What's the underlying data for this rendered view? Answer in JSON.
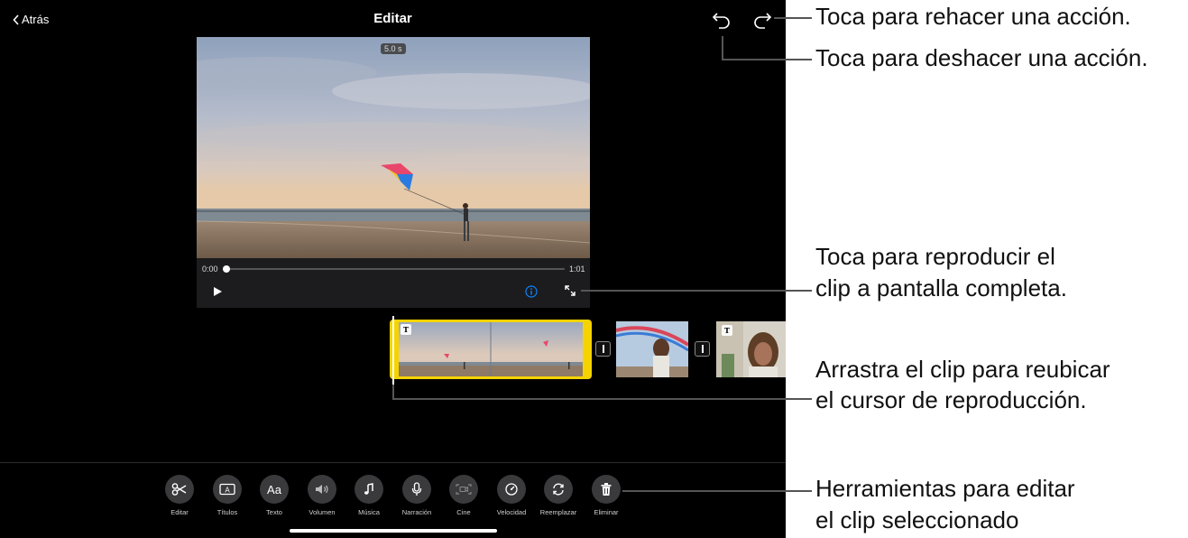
{
  "header": {
    "back_label": "Atrás",
    "title": "Editar"
  },
  "viewer": {
    "duration_badge": "5.0 s",
    "time_current": "0:00",
    "time_total": "1:01",
    "progress": 0.0
  },
  "timeline": {
    "title_marker": "T"
  },
  "toolbar": [
    {
      "label": "Editar",
      "icon": "scissors-icon"
    },
    {
      "label": "Títulos",
      "icon": "titles-icon"
    },
    {
      "label": "Texto",
      "icon": "Aa"
    },
    {
      "label": "Volumen",
      "icon": "volume-icon"
    },
    {
      "label": "Música",
      "icon": "music-note-icon"
    },
    {
      "label": "Narración",
      "icon": "microphone-icon"
    },
    {
      "label": "Cine",
      "icon": "cinematic-icon"
    },
    {
      "label": "Velocidad",
      "icon": "speedometer-icon"
    },
    {
      "label": "Reemplazar",
      "icon": "replace-icon"
    },
    {
      "label": "Eliminar",
      "icon": "trash-icon"
    }
  ],
  "callouts": {
    "redo": "Toca para rehacer una acción.",
    "undo": "Toca para deshacer una acción.",
    "fullscreen_line1": "Toca para reproducir el",
    "fullscreen_line2": "clip a pantalla completa.",
    "playhead_line1": "Arrastra el clip para reubicar",
    "playhead_line2": "el cursor de reproducción.",
    "tools_line1": "Herramientas para editar",
    "tools_line2": "el clip seleccionado"
  },
  "colors": {
    "selection": "#f5d300",
    "info_accent": "#0a84ff",
    "background": "#000000"
  }
}
